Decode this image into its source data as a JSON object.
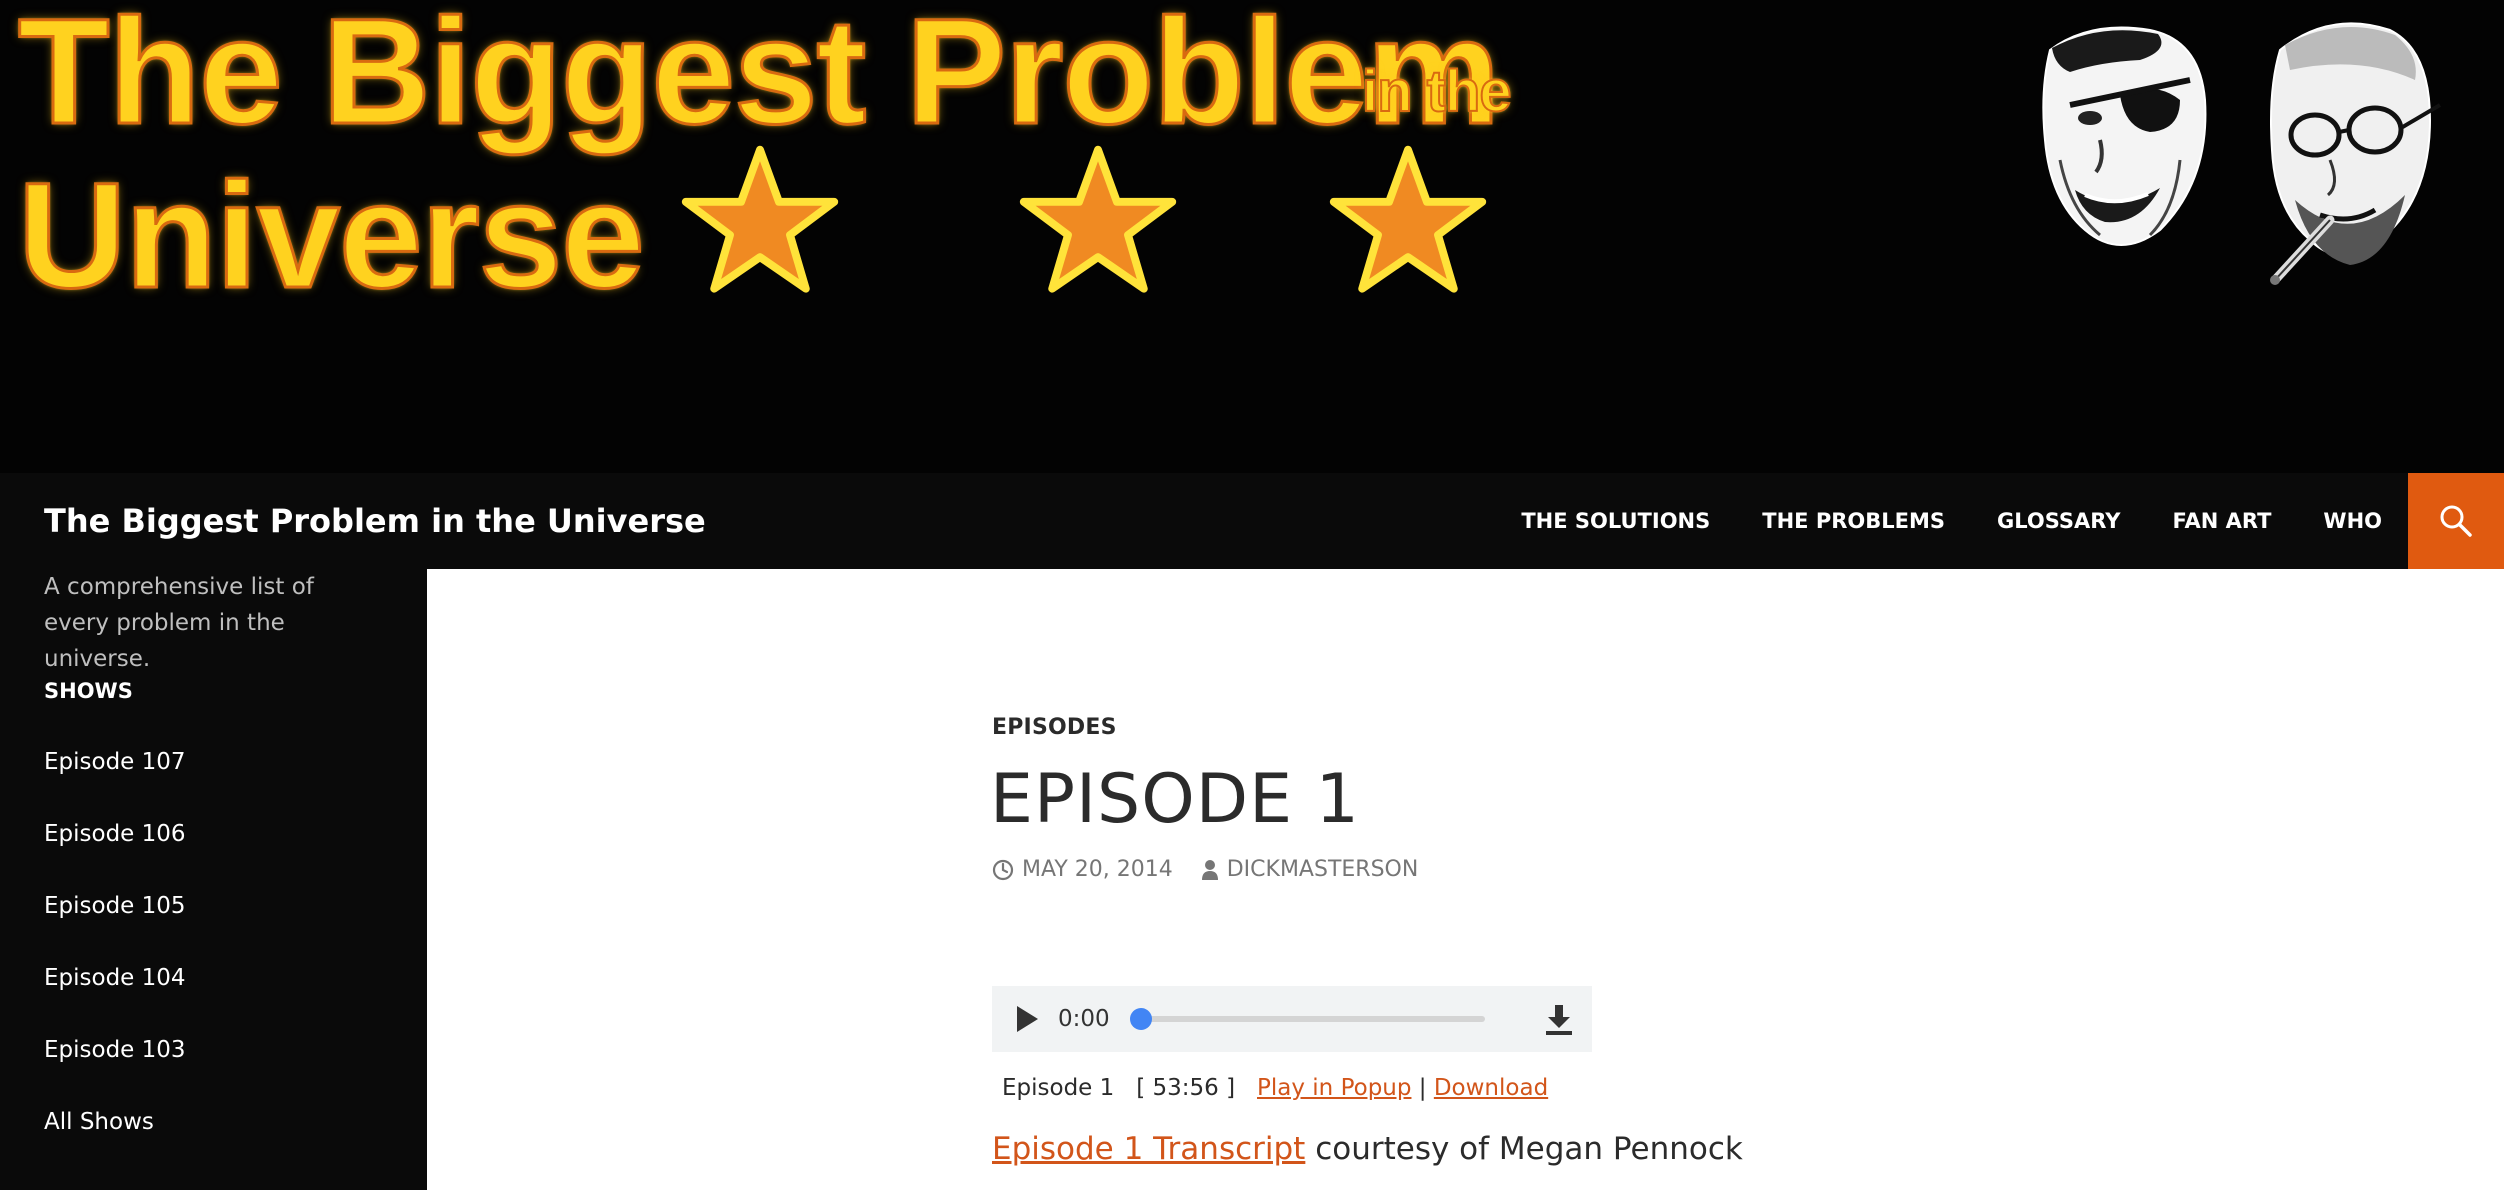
{
  "banner": {
    "line1": "The Biggest Problem",
    "in_the": "in the",
    "line2": "Universe",
    "star_count": 3
  },
  "masthead": {
    "site_title": "The Biggest Problem in the Universe",
    "nav": [
      "THE SOLUTIONS",
      "THE PROBLEMS",
      "GLOSSARY",
      "FAN ART",
      "WHO"
    ],
    "search_icon": "search-icon",
    "accent": "#e05a10"
  },
  "sidebar": {
    "description": "A comprehensive list of every problem in the universe.",
    "widget_title": "SHOWS",
    "shows": [
      "Episode 107",
      "Episode 106",
      "Episode 105",
      "Episode 104",
      "Episode 103",
      "All Shows"
    ]
  },
  "post": {
    "category": "EPISODES",
    "title": "EPISODE 1",
    "date": "MAY 20, 2014",
    "author": "DICKMASTERSON",
    "player": {
      "time": "0:00",
      "progress": 0
    },
    "episode_label": "Episode 1",
    "duration": "[ 53:56 ]",
    "play_popup": "Play in Popup",
    "separator": "|",
    "download": "Download",
    "transcript_link": "Episode 1 Transcript",
    "transcript_credit": "courtesy of Megan Pennock",
    "link_color": "#d2551a"
  }
}
